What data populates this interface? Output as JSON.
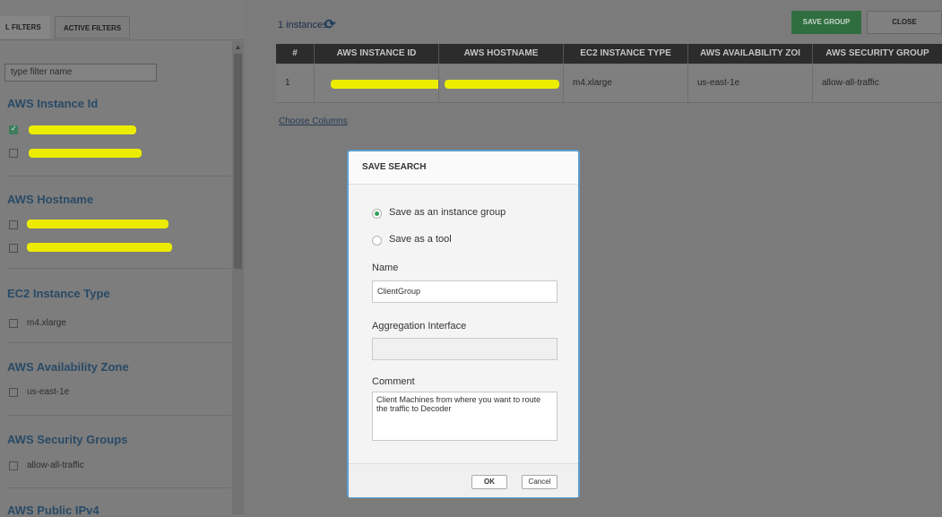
{
  "filters_panel": {
    "tabs": [
      "L FILTERS",
      "ACTIVE FILTERS"
    ],
    "filter_placeholder": "type filter name",
    "groups": [
      {
        "title": "AWS Instance Id",
        "options": [
          {
            "label": "",
            "checked": true,
            "redacted": true
          },
          {
            "label": "",
            "checked": false,
            "redacted": true
          }
        ]
      },
      {
        "title": "AWS Hostname",
        "options": [
          {
            "label": "",
            "checked": false,
            "redacted": true
          },
          {
            "label": "",
            "checked": false,
            "redacted": true
          }
        ]
      },
      {
        "title": "EC2 Instance Type",
        "options": [
          {
            "label": "m4.xlarge",
            "checked": false
          }
        ]
      },
      {
        "title": "AWS Availability Zone",
        "options": [
          {
            "label": "us-east-1e",
            "checked": false
          }
        ]
      },
      {
        "title": "AWS Security Groups",
        "options": [
          {
            "label": "allow-all-traffic",
            "checked": false
          }
        ]
      },
      {
        "title": "AWS Public IPv4",
        "options": []
      }
    ]
  },
  "results": {
    "count_text": "1 instances",
    "refresh_icon": "refresh-icon",
    "save_group_label": "SAVE GROUP",
    "close_label": "CLOSE",
    "columns": [
      "#",
      "AWS INSTANCE ID",
      "AWS HOSTNAME",
      "EC2 INSTANCE TYPE",
      "AWS AVAILABILITY ZOI",
      "AWS SECURITY GROUP"
    ],
    "rows": [
      [
        "1",
        "",
        "",
        "m4.xlarge",
        "us-east-1e",
        "allow-all-traffic"
      ]
    ],
    "choose_columns": "Choose Columns"
  },
  "dialog": {
    "title": "SAVE SEARCH",
    "options": [
      {
        "label": "Save as an instance group",
        "selected": true
      },
      {
        "label": "Save as a tool",
        "selected": false
      }
    ],
    "name_label": "Name",
    "name_value": "ClientGroup",
    "aggregation_label": "Aggregation Interface",
    "aggregation_value": "",
    "comment_label": "Comment",
    "comment_value": "Client Machines from where you want to route the traffic to Decoder",
    "ok_label": "OK",
    "cancel_label": "Cancel"
  },
  "colors": {
    "accent": "#2fa05a",
    "dialog_border": "#5d9fd0",
    "redaction": "#ecec00"
  }
}
